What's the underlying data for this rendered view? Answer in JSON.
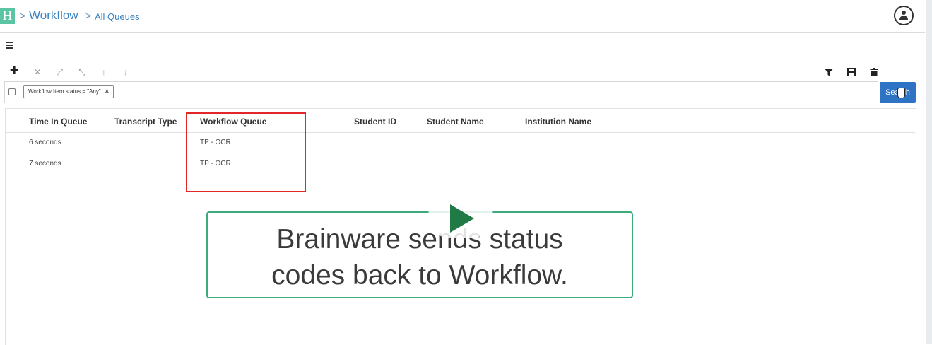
{
  "header": {
    "logo_letter": "H",
    "breadcrumb_sep": ">",
    "breadcrumb_workflow": "Workflow",
    "breadcrumb_all_queues": "All Queues"
  },
  "toolbar": {
    "icons": [
      "plus-icon",
      "close-icon",
      "collapse-icon",
      "expand-icon",
      "arrow-up-icon",
      "arrow-down-icon",
      "filter-icon",
      "save-icon",
      "trash-icon"
    ]
  },
  "search": {
    "filter_chip": "Workflow Item status = \"Any\"",
    "chip_remove": "×",
    "button_label": "Search"
  },
  "table": {
    "columns": [
      "Time In Queue",
      "Transcript Type",
      "Workflow Queue",
      "Student ID",
      "Student Name",
      "Institution Name"
    ],
    "rows": [
      {
        "time_in_queue": "6 seconds",
        "transcript_type": "",
        "workflow_queue": "TP - OCR",
        "student_id": "",
        "student_name": "",
        "institution_name": ""
      },
      {
        "time_in_queue": "7 seconds",
        "transcript_type": "",
        "workflow_queue": "TP - OCR",
        "student_id": "",
        "student_name": "",
        "institution_name": ""
      }
    ]
  },
  "overlay": {
    "caption_line1": "Brainware sends status",
    "caption_line2": "codes back to Workflow.",
    "highlight_color": "#e22826",
    "caption_border_color": "#3dab7c",
    "play_color": "#1f7a45"
  },
  "colors": {
    "accent": "#2f73c4",
    "link": "#3b83c0",
    "logo": "#5bc4a3"
  }
}
